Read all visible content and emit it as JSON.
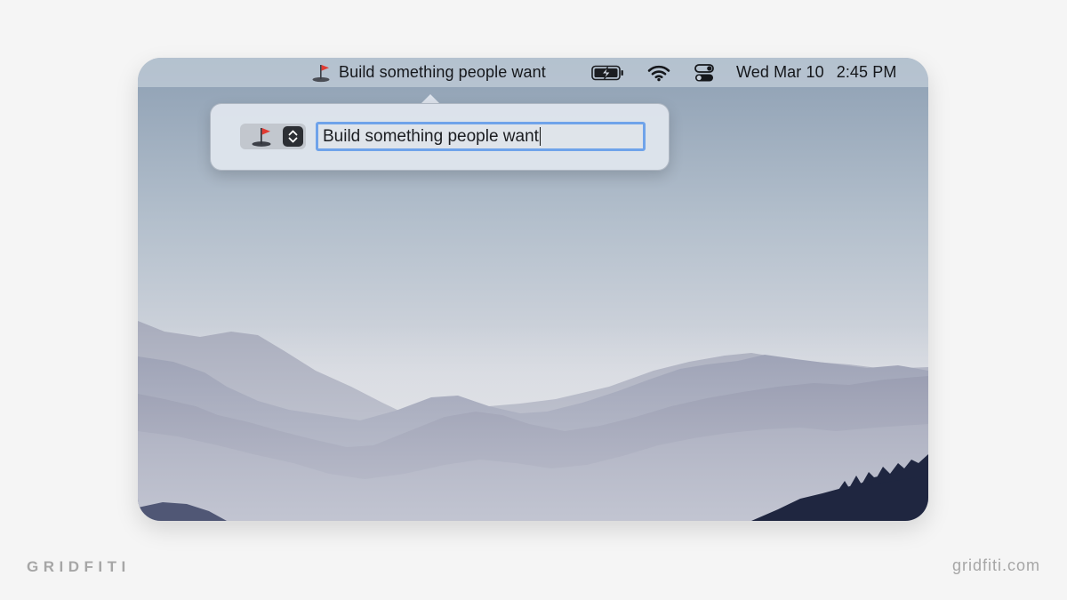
{
  "menubar": {
    "status_item": {
      "icon": "golf-flag-icon",
      "title": "Build something people want"
    },
    "battery_icon": "battery-charging-icon",
    "wifi_icon": "wifi-icon",
    "control_center_icon": "control-center-icon",
    "clock": {
      "date": "Wed Mar 10",
      "time": "2:45 PM"
    }
  },
  "popover": {
    "emoji_picker": {
      "selected_icon": "golf-flag-icon",
      "stepper_icon": "up-down-chevron-icon"
    },
    "title_field": {
      "value": "Build something people want"
    }
  },
  "branding": {
    "left": "GRIDFITI",
    "right": "gridfiti.com"
  },
  "colors": {
    "page_background": "#f5f5f5",
    "focus_ring": "#6fa3ea",
    "menubar_tint": "#c4ceda"
  }
}
